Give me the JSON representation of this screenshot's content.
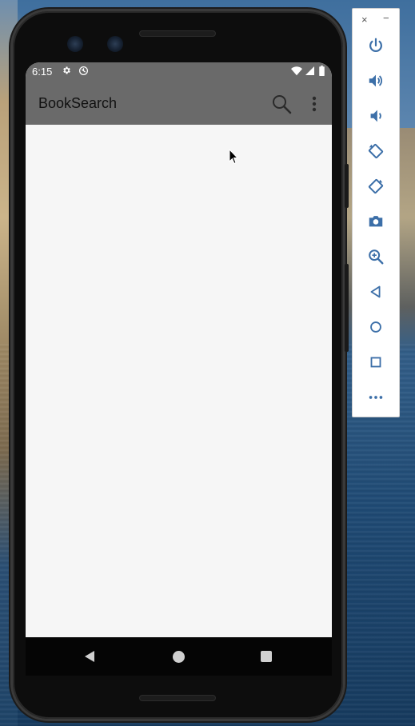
{
  "status_bar": {
    "time": "6:15"
  },
  "app_bar": {
    "title": "BookSearch"
  },
  "emulator_panel": {
    "close_label": "×",
    "minimize_label": "−",
    "buttons": [
      "power-icon",
      "volume-up-icon",
      "volume-down-icon",
      "rotate-left-icon",
      "rotate-right-icon",
      "camera-icon",
      "zoom-icon",
      "back-icon",
      "home-icon",
      "overview-icon",
      "more-icon"
    ]
  },
  "colors": {
    "app_bar": "#6a6a6a",
    "content_bg": "#f6f6f6",
    "emulator_icon": "#3c6fa8"
  }
}
